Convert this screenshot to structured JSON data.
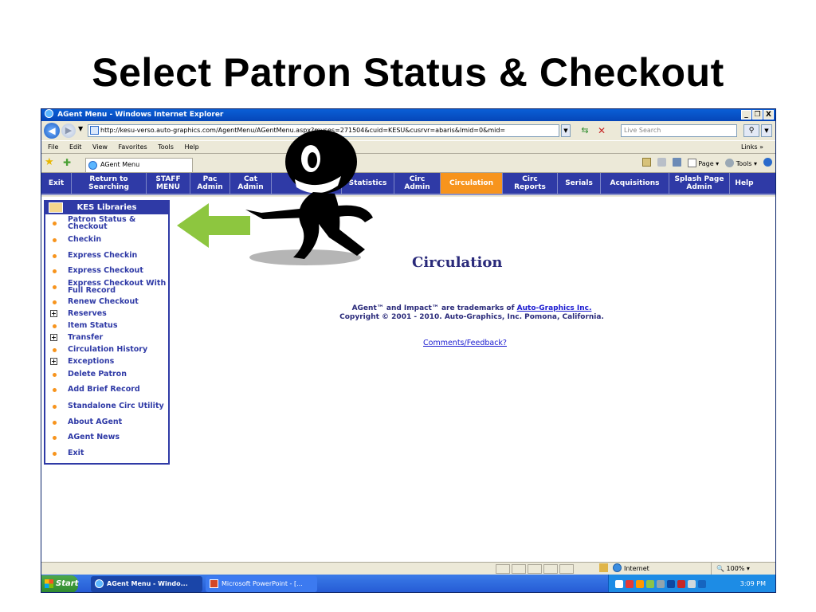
{
  "slide": {
    "title": "Select Patron Status & Checkout"
  },
  "window": {
    "title": "AGent Menu - Windows Internet Explorer",
    "controls": {
      "minimize": "_",
      "restore": "❐",
      "close": "X"
    }
  },
  "address_bar": {
    "url": "http://kesu-verso.auto-graphics.com/AgentMenu/AGentMenu.aspx?myses=271504&cuid=KESU&cusrvr=abaris&lmid=0&mid=",
    "search_placeholder": "Live Search"
  },
  "menu_bar": {
    "items": [
      "File",
      "Edit",
      "View",
      "Favorites",
      "Tools",
      "Help"
    ],
    "links_label": "Links »"
  },
  "tab_bar": {
    "tab_label": "AGent Menu",
    "commands": {
      "page": "Page ▾",
      "tools": "Tools ▾"
    }
  },
  "app_nav": {
    "items": [
      {
        "label": "Exit"
      },
      {
        "label": "Return to\nSearching"
      },
      {
        "label": "STAFF\nMENU"
      },
      {
        "label": "Pac\nAdmin"
      },
      {
        "label": "Cat\nAdmin"
      },
      {
        "label": ""
      },
      {
        "label": "Statistics"
      },
      {
        "label": "Circ\nAdmin"
      },
      {
        "label": "Circulation"
      },
      {
        "label": "Circ\nReports"
      },
      {
        "label": "Serials"
      },
      {
        "label": "Acquisitions"
      },
      {
        "label": "Splash Page\nAdmin"
      },
      {
        "label": "Help"
      }
    ]
  },
  "sidebar": {
    "header": "KES Libraries",
    "items": [
      {
        "label": "Patron Status & Checkout",
        "icon": "bullet"
      },
      {
        "label": "Checkin",
        "icon": "bullet"
      },
      {
        "label": "Express Checkin",
        "icon": "bullet"
      },
      {
        "label": "Express Checkout",
        "icon": "bullet"
      },
      {
        "label": "Express Checkout With Full Record",
        "icon": "bullet"
      },
      {
        "label": "Renew Checkout",
        "icon": "bullet"
      },
      {
        "label": "Reserves",
        "icon": "expand"
      },
      {
        "label": "Item Status",
        "icon": "bullet"
      },
      {
        "label": "Transfer",
        "icon": "expand"
      },
      {
        "label": "Circulation History",
        "icon": "bullet"
      },
      {
        "label": "Exceptions",
        "icon": "expand"
      },
      {
        "label": "Delete Patron",
        "icon": "bullet"
      },
      {
        "label": "Add Brief Record",
        "icon": "bullet"
      },
      {
        "label": "Standalone Circ Utility",
        "icon": "bullet"
      },
      {
        "label": "About AGent",
        "icon": "bullet"
      },
      {
        "label": "AGent News",
        "icon": "bullet"
      },
      {
        "label": "Exit",
        "icon": "bullet"
      }
    ]
  },
  "main": {
    "heading": "Circulation",
    "trademark_line1_prefix": "AGent™ and Impact™ are trademarks of ",
    "trademark_link": "Auto-Graphics Inc.",
    "trademark_line2": "Copyright © 2001 - 2010. Auto-Graphics, Inc. Pomona, California.",
    "feedback_link": "Comments/Feedback?"
  },
  "status_bar": {
    "zone": "Internet",
    "zoom": "100%"
  },
  "taskbar": {
    "start_label": "Start",
    "tasks": [
      "AGent Menu - Windo...",
      "Microsoft PowerPoint - [..."
    ],
    "clock": "3:09 PM"
  },
  "colors": {
    "nav_bg": "#2f3aa6",
    "nav_active": "#f7941d",
    "arrow": "#8dc63f"
  }
}
